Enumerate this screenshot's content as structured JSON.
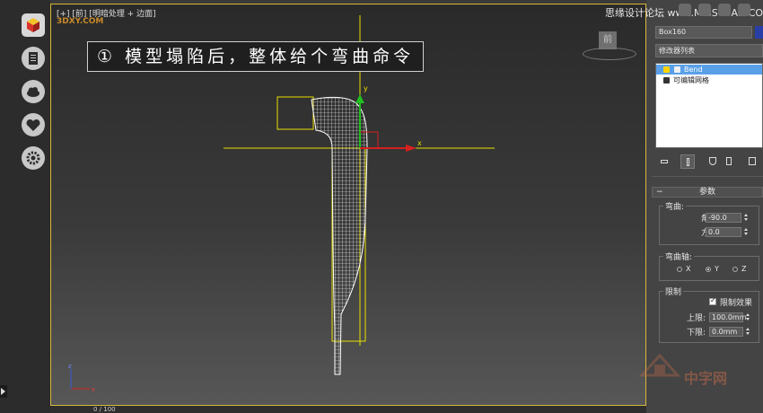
{
  "viewport": {
    "label": "[+] [前] [明暗处理 + 边面]",
    "watermark": "3DXY.COM",
    "banner": "① 模型塌陷后，整体给个弯曲命令",
    "viewcube_label": "前",
    "status_text": "0 / 100"
  },
  "left_sidebar": {
    "icons": [
      "3d-cube-logo-icon",
      "document-icon",
      "cloud-icon",
      "heart-icon",
      "gear-icon"
    ]
  },
  "panel": {
    "site_watermark": "思缘设计论坛 www.MISSYUAN.COM",
    "object_name": "Box160",
    "object_color": "#2a3ea8",
    "modifier_list_label": "修改器列表",
    "stack": [
      {
        "label": "Bend",
        "selected": true
      },
      {
        "label": "可编辑网格",
        "selected": false
      }
    ],
    "rollout_title": "参数",
    "bend": {
      "group_title": "弯曲:",
      "angle_label": "角度:",
      "angle_value": "-90.0",
      "direction_label": "方向:",
      "direction_value": "0.0"
    },
    "bend_axis": {
      "group_title": "弯曲轴:",
      "options": [
        "X",
        "Y",
        "Z"
      ],
      "selected": "Y"
    },
    "limits": {
      "group_title": "限制",
      "limit_effect_label": "限制效果",
      "limit_effect_checked": true,
      "upper_label": "上限:",
      "upper_value": "100.0mm",
      "lower_label": "下限:",
      "lower_value": "0.0mm"
    }
  },
  "colors": {
    "selection_outline": "#d8b63c",
    "wireframe": "#ffffff",
    "gizmo_yellow": "#e8e000",
    "axis_x": "#d62020",
    "axis_y": "#20c020",
    "stack_selected": "#5aa0e8"
  },
  "bottom_watermark": "中字网"
}
